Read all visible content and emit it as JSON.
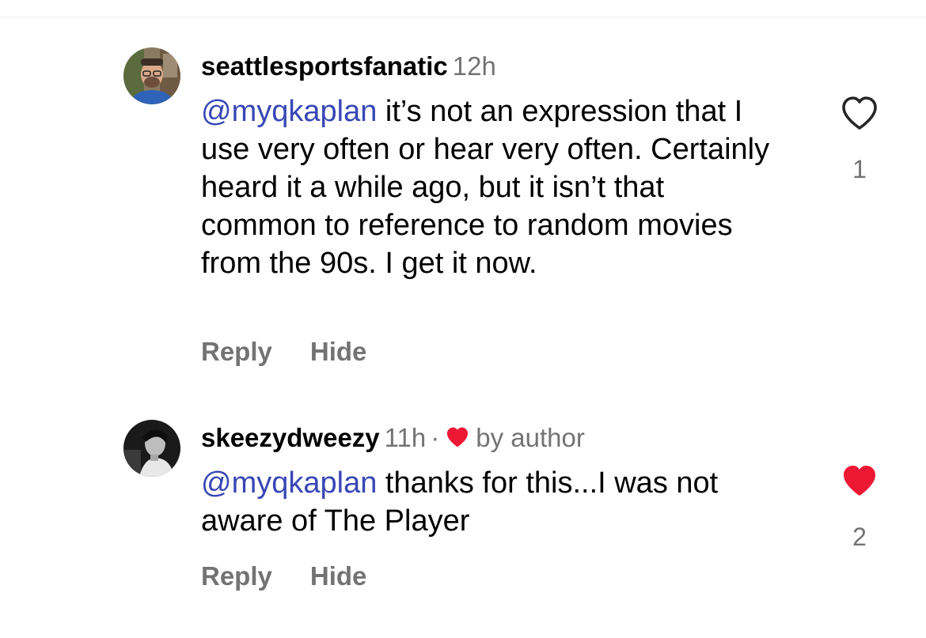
{
  "colors": {
    "mention": "#3847b5",
    "secondary_text": "#737373",
    "liked_heart": "#ed1834"
  },
  "comments": [
    {
      "username": "seattlesportsfanatic",
      "time": "12h",
      "mention": "@myqkaplan",
      "text": " it’s not an expression that I use very often or hear very often. Certainly heard it a while ago, but it isn’t that common to reference to random movies from the 90s. I get it now.",
      "reply_label": "Reply",
      "hide_label": "Hide",
      "like_icon": "heart-outline-icon",
      "liked": false,
      "like_count": "1"
    },
    {
      "username": "skeezydweezy",
      "time": "11h",
      "separator": "·",
      "author_badge_icon": "heart-filled-icon",
      "author_badge_text": "by author",
      "mention": "@myqkaplan",
      "text": " thanks for this...I was not aware of The Player",
      "reply_label": "Reply",
      "hide_label": "Hide",
      "like_icon": "heart-filled-icon",
      "liked": true,
      "like_count": "2"
    }
  ]
}
